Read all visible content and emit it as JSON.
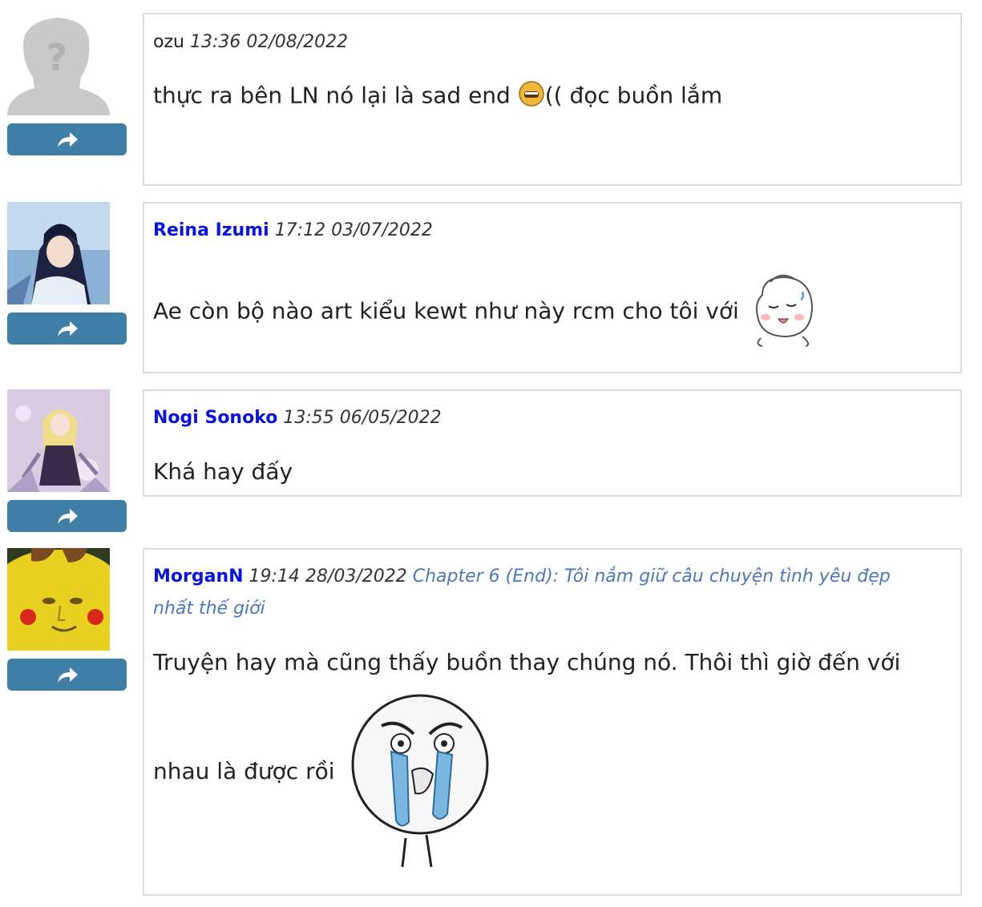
{
  "comments": [
    {
      "username": "ozu",
      "time": "13:36 02/08/2022",
      "text_before": "thực ra bên LN nó lại là sad end",
      "text_after": "(( đọc buồn lắm",
      "avatar": "default-avatar-icon",
      "emoji": "sad-face-emoji-icon"
    },
    {
      "username": "Reina Izumi",
      "time": "17:12 03/07/2022",
      "text": "Ae còn bộ nào art kiểu kewt như này rcm cho tôi với",
      "avatar": "anime-girl-avatar",
      "emoji": "sweat-blush-bun-emoji"
    },
    {
      "username": "Nogi Sonoko",
      "time": "13:55 06/05/2022",
      "text": "Khá hay đấy",
      "avatar": "anime-girl-avatar"
    },
    {
      "username": "MorganN",
      "time": "19:14 28/03/2022",
      "chapter": "Chapter 6 (End): Tôi nắm giữ câu chuyện tình yêu đẹp",
      "chapter_line2": "nhất thế giới",
      "text_line1": "Truyện hay mà cũng thấy buồn thay chúng nó. Thôi thì giờ đến với",
      "text_line2": "nhau là được rồi",
      "avatar": "pikachu-face-avatar",
      "emoji": "crying-rage-face-emoji"
    }
  ],
  "colors": {
    "username": "#0a14d6",
    "chapter_link": "#4a78ba",
    "reply_button": "#3f7ea6",
    "box_border": "#dcdcdc"
  }
}
